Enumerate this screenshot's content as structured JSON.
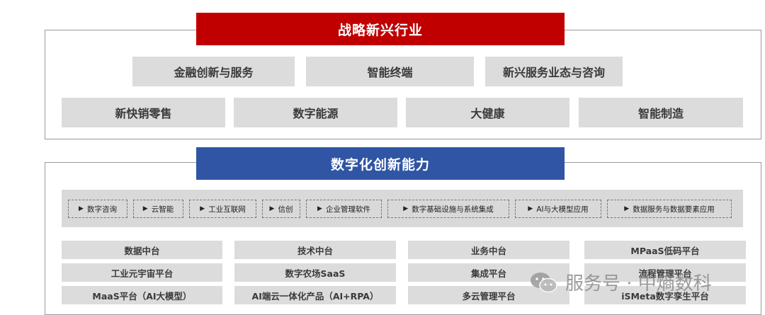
{
  "section1": {
    "title": "战略新兴行业",
    "title_color": "#c00000",
    "row1": [
      "金融创新与服务",
      "智能终端",
      "新兴服务业态与咨询"
    ],
    "row2": [
      "新快销零售",
      "数字能源",
      "大健康",
      "智能制造"
    ]
  },
  "section2": {
    "title": "数字化创新能力",
    "title_color": "#2f55a4",
    "tags": [
      "数字咨询",
      "云智能",
      "工业互联网",
      "信创",
      "企业管理软件",
      "数字基础设施与系统集成",
      "AI与大模型应用",
      "数据服务与数据要素应用"
    ],
    "grid": [
      [
        "数据中台",
        "技术中台",
        "业务中台",
        "MPaaS低码平台"
      ],
      [
        "工业元宇宙平台",
        "数字农场SaaS",
        "集成平台",
        "流程管理平台"
      ],
      [
        "MaaS平台（AI大模型）",
        "AI端云一体化产品（AI+RPA）",
        "多云管理平台",
        "iSMeta数字孪生平台"
      ]
    ]
  },
  "watermark": {
    "text": "服务号 · 中熵数科",
    "icon": "wechat-icon"
  }
}
